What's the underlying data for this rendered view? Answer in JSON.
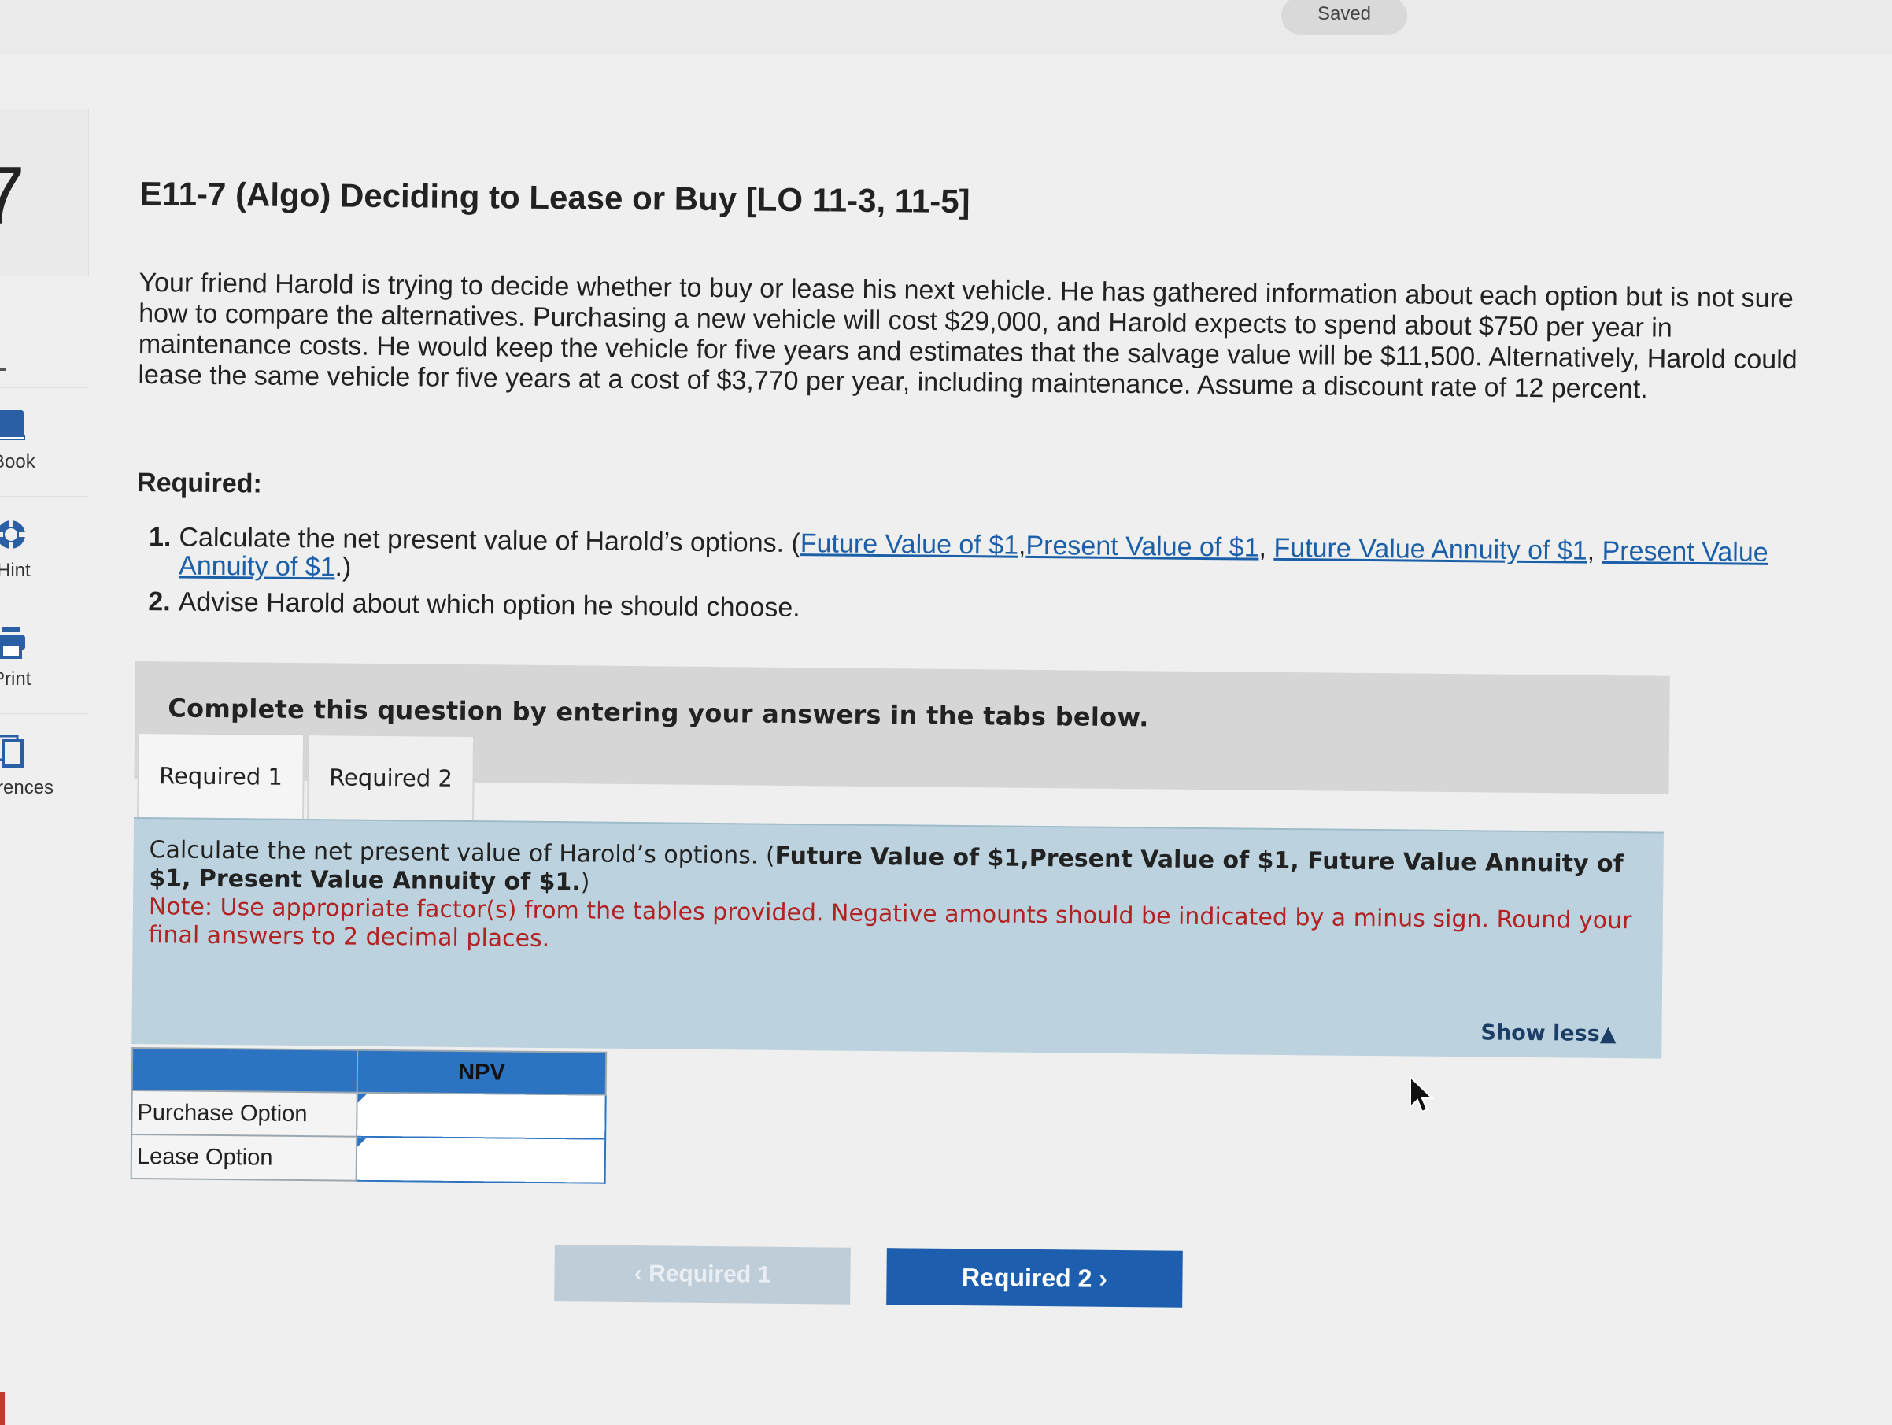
{
  "topbar": {
    "saved_label": "Saved"
  },
  "question_number": "7",
  "sidebar": {
    "items": [
      {
        "label": "Book",
        "icon": "book-icon"
      },
      {
        "label": "Hint",
        "icon": "hint-icon"
      },
      {
        "label": "Print",
        "icon": "print-icon"
      },
      {
        "label": "rences",
        "icon": "references-icon"
      }
    ]
  },
  "problem": {
    "title": "E11-7 (Algo) Deciding to Lease or Buy [LO 11-3, 11-5]",
    "description": "Your friend Harold is trying to decide whether to buy or lease his next vehicle. He has gathered information about each option but is not sure how to compare the alternatives. Purchasing a new vehicle will cost $29,000, and Harold expects to spend about $750 per year in maintenance costs. He would keep the vehicle for five years and estimates that the salvage value will be $11,500. Alternatively, Harold could lease the same vehicle for five years at a cost of $3,770 per year, including maintenance. Assume a discount rate of 12 percent.",
    "required_heading": "Required:",
    "req1_prefix": "Calculate the net present value of Harold’s options. (",
    "req1_link1": "Future Value of $1",
    "req1_sep1": ",",
    "req1_link2": "Present Value of $1",
    "req1_sep2": ", ",
    "req1_link3": "Future Value Annuity of $1",
    "req1_sep3": ", ",
    "req1_link4": "Present Value Annuity of $1",
    "req1_suffix": ".)",
    "req1_num": "1.",
    "req2_num": "2.",
    "req2_text": "Advise Harold about which option he should choose."
  },
  "instructions": "Complete this question by entering your answers in the tabs below.",
  "tabs": [
    {
      "label": "Required 1"
    },
    {
      "label": "Required 2"
    }
  ],
  "panel": {
    "lead": "Calculate the net present value of Harold’s options. (",
    "bold": "Future Value of $1,Present Value of $1, Future Value Annuity of $1, Present Value Annuity of $1.",
    "tail": ")",
    "note": "Note: Use appropriate factor(s) from the tables provided. Negative amounts should be indicated by a minus sign. Round your final answers to 2 decimal places.",
    "show_less": "Show less"
  },
  "table": {
    "header": "NPV",
    "rows": [
      {
        "label": "Purchase Option",
        "value": ""
      },
      {
        "label": "Lease Option",
        "value": ""
      }
    ]
  },
  "nav": {
    "prev_label": "Required 1",
    "next_label": "Required 2"
  },
  "colors": {
    "accent": "#1d5fae",
    "panel": "#bcd3df",
    "note": "#b22222",
    "link": "#1a5fa8"
  }
}
